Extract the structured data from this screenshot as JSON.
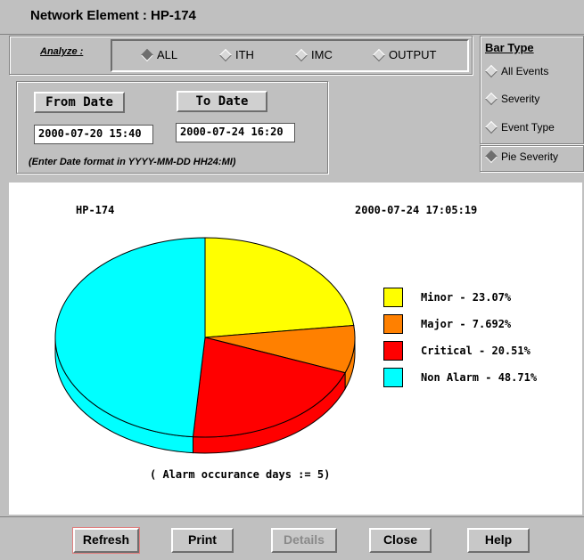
{
  "window": {
    "title": "Network Element : HP-174"
  },
  "analyze": {
    "label": "Analyze :",
    "options": [
      {
        "label": "ALL",
        "selected": true
      },
      {
        "label": "ITH",
        "selected": false
      },
      {
        "label": "IMC",
        "selected": false
      },
      {
        "label": "OUTPUT",
        "selected": false
      }
    ]
  },
  "dates": {
    "from_label": "From Date",
    "to_label": "To Date",
    "from_value": "2000-07-20 15:40",
    "to_value": "2000-07-24 16:20",
    "hint": "(Enter Date format in YYYY-MM-DD HH24:MI)"
  },
  "bar_type": {
    "title": "Bar Type",
    "options": [
      {
        "label": "All Events",
        "selected": false
      },
      {
        "label": "Severity",
        "selected": false
      },
      {
        "label": "Event Type",
        "selected": false
      }
    ],
    "pie_option": {
      "label": "Pie Severity",
      "selected": true
    }
  },
  "chart_header": {
    "element": "HP-174",
    "timestamp": "2000-07-24 17:05:19"
  },
  "chart_data": {
    "type": "pie",
    "slices": [
      {
        "label": "Minor - 23.07%",
        "value": 23.07,
        "color": "#ffff00"
      },
      {
        "label": "Major - 7.692%",
        "value": 7.692,
        "color": "#ff8000"
      },
      {
        "label": "Critical - 20.51%",
        "value": 20.51,
        "color": "#ff0000"
      },
      {
        "label": "Non Alarm - 48.71%",
        "value": 48.71,
        "color": "#00ffff"
      }
    ],
    "caption": "( Alarm occurance days := 5)"
  },
  "footer": {
    "refresh": "Refresh",
    "print": "Print",
    "details": "Details",
    "close": "Close",
    "help": "Help"
  }
}
